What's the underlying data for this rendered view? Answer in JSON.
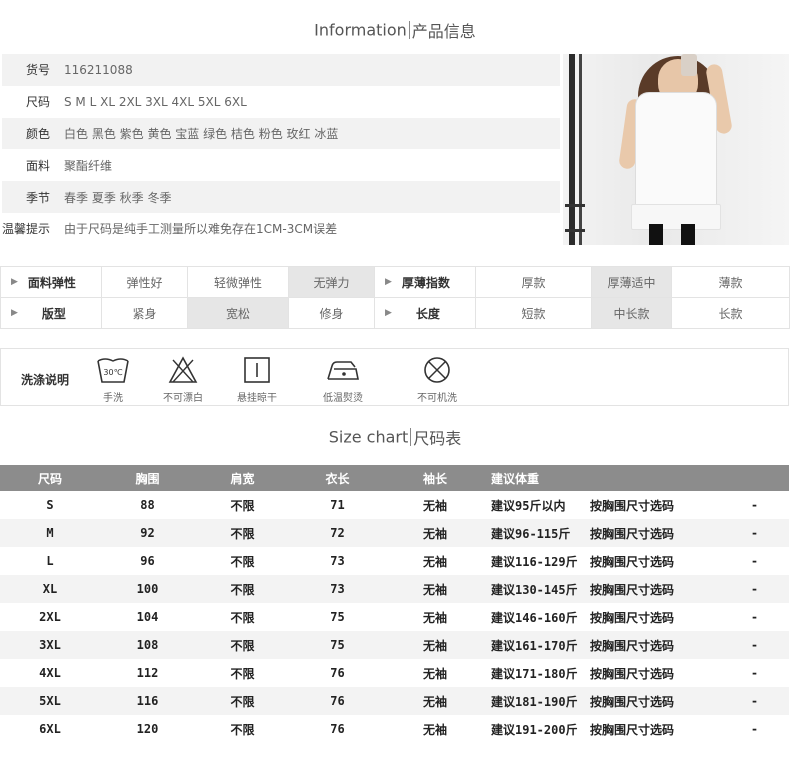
{
  "info_heading": {
    "en": "Information",
    "cn": "产品信息"
  },
  "info_rows": [
    {
      "key": "货号",
      "value": "116211088"
    },
    {
      "key": "尺码",
      "value": "S  M  L  XL  2XL  3XL  4XL  5XL  6XL"
    },
    {
      "key": "颜色",
      "value": "白色  黑色  紫色  黄色  宝蓝  绿色  桔色  粉色  玫红  冰蓝"
    },
    {
      "key": "面料",
      "value": "聚酯纤维"
    },
    {
      "key": "季节",
      "value": "春季  夏季  秋季  冬季"
    },
    {
      "key": "温馨提示",
      "value": "由于尺码是纯手工测量所以难免存在1CM-3CM误差"
    }
  ],
  "attributes": {
    "row1": {
      "label1": "面料弹性",
      "opts1": [
        "弹性好",
        "轻微弹性",
        "无弹力"
      ],
      "sel1": 2,
      "label2": "厚薄指数",
      "opts2": [
        "厚款",
        "厚薄适中",
        "薄款"
      ],
      "sel2": 1
    },
    "row2": {
      "label1": "版型",
      "opts1": [
        "紧身",
        "宽松",
        "修身"
      ],
      "sel1": 1,
      "label2": "长度",
      "opts2": [
        "短款",
        "中长款",
        "长款"
      ],
      "sel2": 1
    }
  },
  "wash": {
    "title": "洗涤说明",
    "temp": "30℃",
    "items": [
      {
        "icon": "hand-wash-icon",
        "label": "手洗"
      },
      {
        "icon": "no-bleach-icon",
        "label": "不可漂白"
      },
      {
        "icon": "hang-dry-icon",
        "label": "悬挂晾干"
      },
      {
        "icon": "low-iron-icon",
        "label": "低温熨烫"
      },
      {
        "icon": "no-machine-wash-icon",
        "label": "不可机洗"
      }
    ]
  },
  "size_heading": {
    "en": "Size chart",
    "cn": "尺码表"
  },
  "size_table": {
    "headers": [
      "尺码",
      "胸围",
      "肩宽",
      "衣长",
      "袖长",
      "建议体重",
      "",
      ""
    ],
    "rows": [
      [
        "S",
        "88",
        "不限",
        "71",
        "无袖",
        "建议95斤以内",
        "按胸围尺寸选码",
        "-"
      ],
      [
        "M",
        "92",
        "不限",
        "72",
        "无袖",
        "建议96-115斤",
        "按胸围尺寸选码",
        "-"
      ],
      [
        "L",
        "96",
        "不限",
        "73",
        "无袖",
        "建议116-129斤",
        "按胸围尺寸选码",
        "-"
      ],
      [
        "XL",
        "100",
        "不限",
        "73",
        "无袖",
        "建议130-145斤",
        "按胸围尺寸选码",
        "-"
      ],
      [
        "2XL",
        "104",
        "不限",
        "75",
        "无袖",
        "建议146-160斤",
        "按胸围尺寸选码",
        "-"
      ],
      [
        "3XL",
        "108",
        "不限",
        "75",
        "无袖",
        "建议161-170斤",
        "按胸围尺寸选码",
        "-"
      ],
      [
        "4XL",
        "112",
        "不限",
        "76",
        "无袖",
        "建议171-180斤",
        "按胸围尺寸选码",
        "-"
      ],
      [
        "5XL",
        "116",
        "不限",
        "76",
        "无袖",
        "建议181-190斤",
        "按胸围尺寸选码",
        "-"
      ],
      [
        "6XL",
        "120",
        "不限",
        "76",
        "无袖",
        "建议191-200斤",
        "按胸围尺寸选码",
        "-"
      ]
    ]
  }
}
